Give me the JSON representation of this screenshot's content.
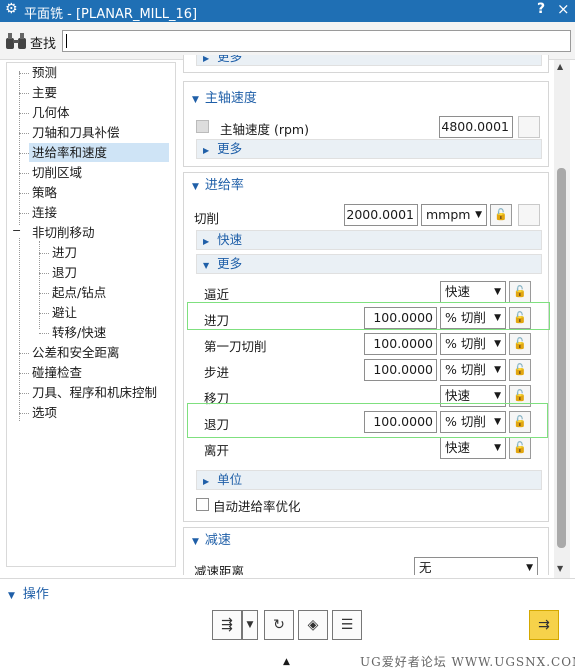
{
  "titlebar": {
    "title": "平面铣 - [PLANAR_MILL_16]",
    "help": "?",
    "close": "×",
    "gear_icon": "gear-icon"
  },
  "search": {
    "label": "查找",
    "value": ""
  },
  "tree": {
    "items": [
      {
        "label": "预测"
      },
      {
        "label": "主要"
      },
      {
        "label": "几何体"
      },
      {
        "label": "刀轴和刀具补偿"
      },
      {
        "label": "进给率和速度"
      },
      {
        "label": "切削区域"
      },
      {
        "label": "策略"
      },
      {
        "label": "连接"
      },
      {
        "label": "非切削移动"
      },
      {
        "label": "进刀"
      },
      {
        "label": "退刀"
      },
      {
        "label": "起点/钻点"
      },
      {
        "label": "避让"
      },
      {
        "label": "转移/快速"
      },
      {
        "label": "公差和安全距离"
      },
      {
        "label": "碰撞检查"
      },
      {
        "label": "刀具、程序和机床控制"
      },
      {
        "label": "选项"
      }
    ],
    "expander": "−"
  },
  "spindle": {
    "top_more": "更多",
    "header": "主轴速度",
    "speed_label": "主轴速度 (rpm)",
    "speed_value": "4800.0001",
    "more": "更多"
  },
  "feed": {
    "header": "进给率",
    "cut_label": "切削",
    "cut_value": "2000.0001",
    "cut_unit": "mmpm",
    "rapid": "快速",
    "more": "更多",
    "rows": [
      {
        "label": "逼近",
        "value": "",
        "unit": "快速"
      },
      {
        "label": "进刀",
        "value": "100.0000",
        "unit": "% 切削"
      },
      {
        "label": "第一刀切削",
        "value": "100.0000",
        "unit": "% 切削"
      },
      {
        "label": "步进",
        "value": "100.0000",
        "unit": "% 切削"
      },
      {
        "label": "移刀",
        "value": "",
        "unit": "快速"
      },
      {
        "label": "退刀",
        "value": "100.0000",
        "unit": "% 切削"
      },
      {
        "label": "离开",
        "value": "",
        "unit": "快速"
      }
    ],
    "units": "单位",
    "auto_opt": "自动进给率优化"
  },
  "decel": {
    "header": "减速",
    "dist_label": "减速距离",
    "dist_value": "无"
  },
  "actions": {
    "header": "操作"
  },
  "watermark": "UG爱好者论坛 WWW.UGSNX.COM"
}
